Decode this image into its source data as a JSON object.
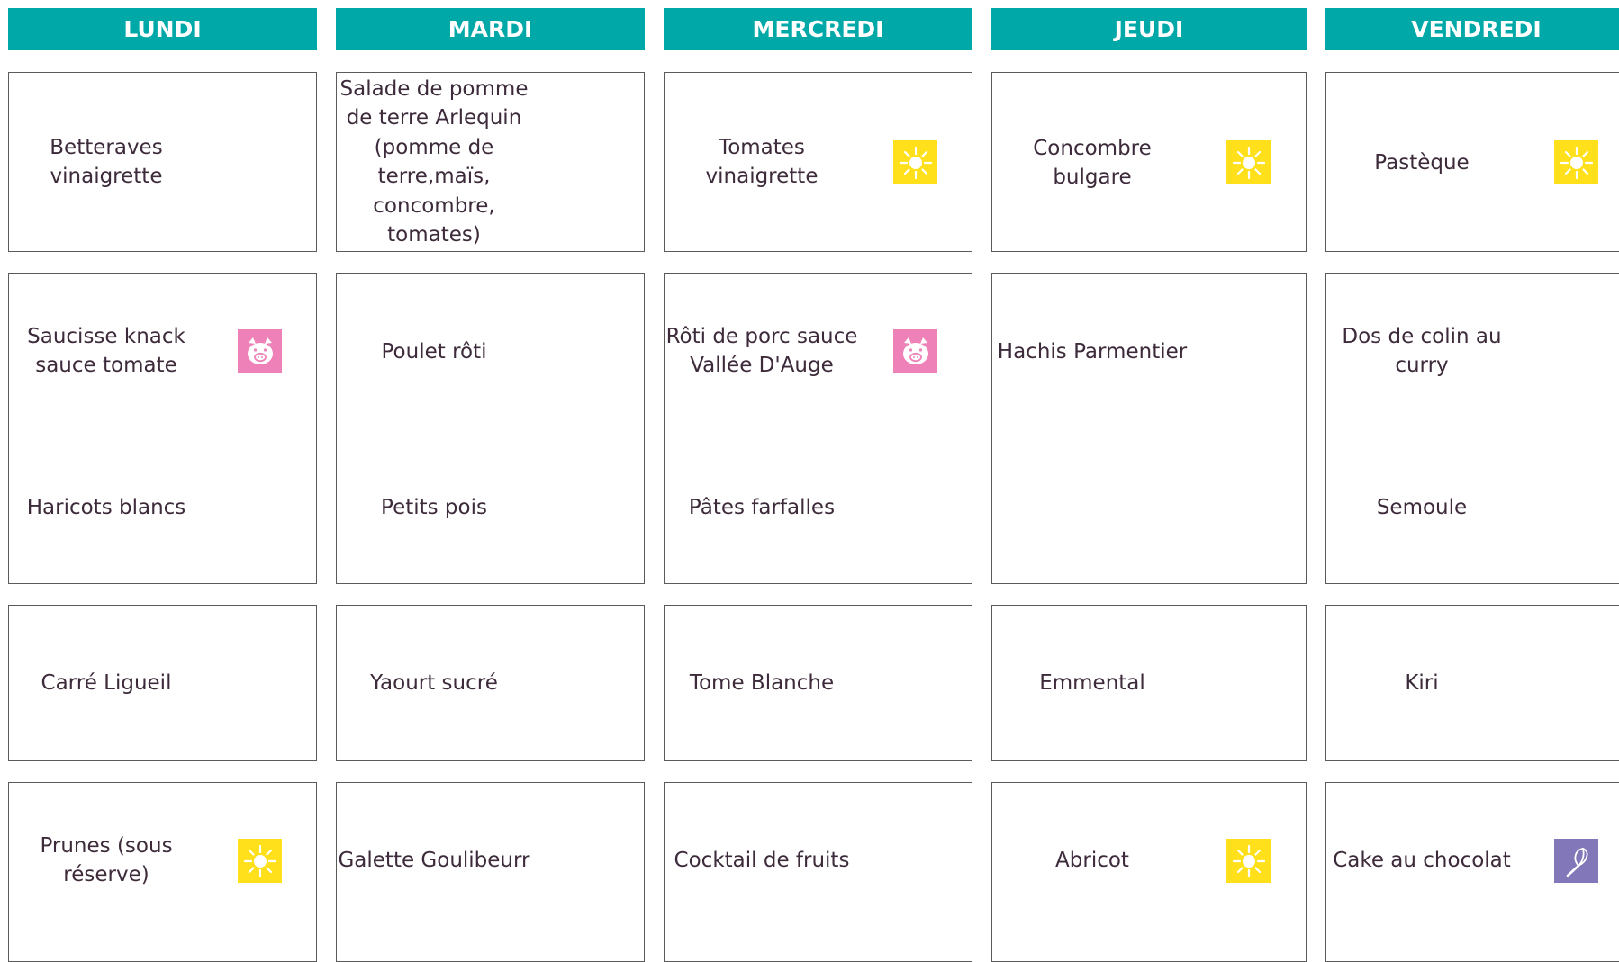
{
  "days": [
    "LUNDI",
    "MARDI",
    "MERCREDI",
    "JEUDI",
    "VENDREDI"
  ],
  "colors": {
    "header_bg": "#00a8a8",
    "header_text": "#ffffff",
    "text": "#3d2b3b",
    "border": "#5a5a5a",
    "badge_seasonal": "#ffe01a",
    "badge_pork": "#ee82b8",
    "badge_homemade": "#8277b8"
  },
  "menu": {
    "lundi": {
      "entree": "Betteraves\nvinaigrette",
      "plat": "Saucisse knack\nsauce tomate",
      "plat_icon": "pig-icon",
      "accompagnement": "Haricots blancs",
      "fromage": "Carré Ligueil",
      "dessert": "Prunes (sous\nréserve)",
      "dessert_icon": "sun-icon"
    },
    "mardi": {
      "entree": "Salade de pomme\nde terre Arlequin\n(pomme de\nterre,maïs,\nconcombre,\ntomates)",
      "plat": "Poulet rôti",
      "accompagnement": "Petits pois",
      "fromage": "Yaourt sucré",
      "dessert": "Galette Goulibeurr"
    },
    "mercredi": {
      "entree": "Tomates\nvinaigrette",
      "entree_icon": "sun-icon",
      "plat": "Rôti de porc sauce\nVallée D'Auge",
      "plat_icon": "pig-icon",
      "accompagnement": "Pâtes farfalles",
      "fromage": "Tome Blanche",
      "dessert": "Cocktail de fruits"
    },
    "jeudi": {
      "entree": "Concombre bulgare",
      "entree_icon": "sun-icon",
      "plat": "Hachis Parmentier",
      "fromage": "Emmental",
      "dessert": "Abricot",
      "dessert_icon": "sun-icon"
    },
    "vendredi": {
      "entree": "Pastèque",
      "entree_icon": "sun-icon",
      "plat": "Dos de colin au\ncurry",
      "accompagnement": "Semoule",
      "fromage": "Kiri",
      "dessert": "Cake au chocolat",
      "dessert_icon": "whisk-icon"
    }
  }
}
